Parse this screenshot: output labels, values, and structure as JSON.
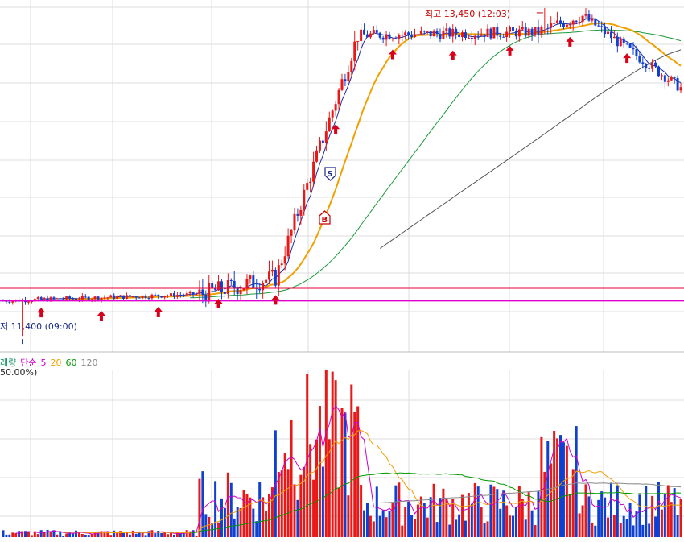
{
  "annotations": {
    "high_label": "최고 13,450 (12:03)",
    "low_label": "저 11,400 (09:00)",
    "sell_marker": "S",
    "buy_marker": "B"
  },
  "volume_panel": {
    "legend_prefix": "래량",
    "legend_type": "단순",
    "ma_labels": [
      "5",
      "20",
      "60",
      "120"
    ],
    "ma_colors": [
      "#cc00cc",
      "#f0a000",
      "#009900",
      "#888888"
    ],
    "sub_label": "50.00%)"
  },
  "colors": {
    "up": "#e81818",
    "down": "#1040d0",
    "ma5_price": "#1a2aa0",
    "ma20_price": "#f0a000",
    "ma60_price": "#1a9a3a",
    "ma120_price": "#555555",
    "resistance": "#e8003a",
    "support": "#e000d0",
    "grid": "#dcdcdc"
  },
  "chart_data": [
    {
      "type": "candlestick",
      "high": {
        "value": 13450,
        "time": "12:03"
      },
      "low": {
        "value": 11400,
        "time": "09:00"
      },
      "horizontal_lines": [
        11700,
        11620
      ],
      "buy_signals": 11,
      "series_shape": [
        {
          "phase": "flat",
          "from": 11620,
          "to": 11660,
          "bars": 62
        },
        {
          "phase": "spike",
          "from": 11660,
          "to": 11760,
          "bars": 24
        },
        {
          "phase": "rally",
          "from": 11760,
          "to": 13280,
          "bars": 27
        },
        {
          "phase": "plateau",
          "from": 13280,
          "to": 13300,
          "bars": 56
        },
        {
          "phase": "peak",
          "from": 13300,
          "to": 13400,
          "bars": 14
        },
        {
          "phase": "decline",
          "from": 13400,
          "to": 12950,
          "bars": 32
        }
      ]
    },
    {
      "type": "bar",
      "name": "volume",
      "moving_averages": [
        5,
        20,
        60,
        120
      ]
    }
  ]
}
